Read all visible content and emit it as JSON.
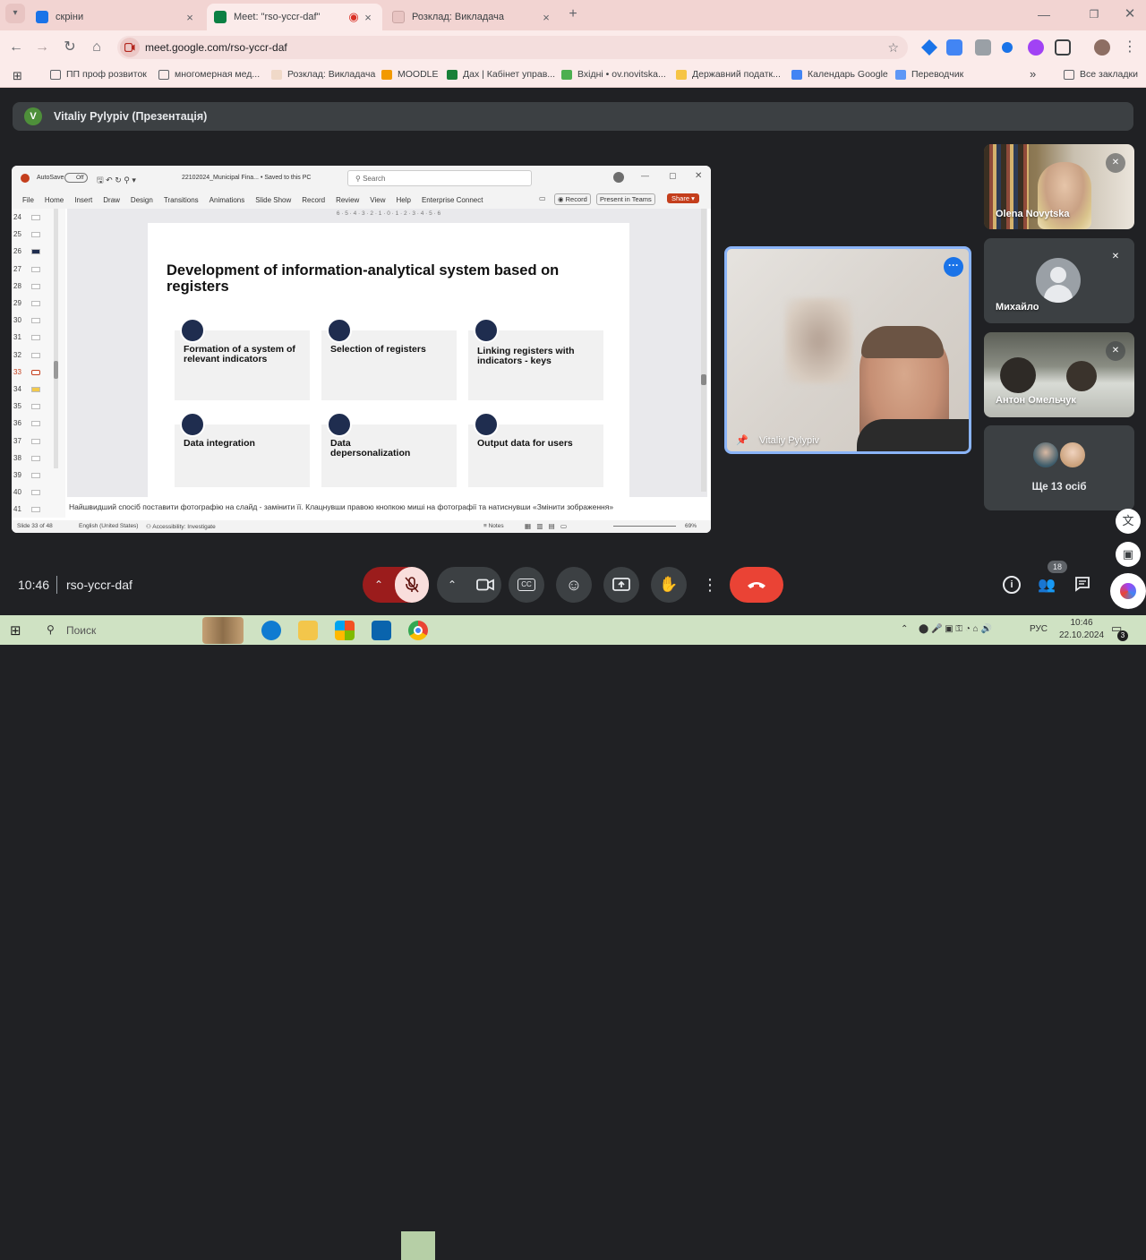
{
  "browser": {
    "tabs": [
      {
        "title": "скріни",
        "color": "#1a73e8"
      },
      {
        "title": "Meet: \"rso-yccr-daf\"",
        "color": "#0b8043"
      },
      {
        "title": "Розклад: Викладача",
        "color": "#e8c4c2"
      }
    ],
    "new_tab": "+",
    "url": "meet.google.com/rso-yccr-daf",
    "bookmarks": [
      "ПП проф розвиток",
      "многомерная мед...",
      "Розклад: Викладача",
      "MOODLE",
      "Дах | Кабінет управ...",
      "Вхідні • ov.novitska...",
      "Державний податк...",
      "Календарь Google",
      "Переводчик",
      "Все закладки"
    ],
    "more": "»"
  },
  "meet": {
    "presenter_initial": "V",
    "presenter_label": "Vitaliy Pylypiv (Презентація)",
    "meeting_code": "rso-yccr-daf",
    "time": "10:46",
    "participants_count": "18",
    "participants": [
      {
        "name": "Olena Novytska"
      },
      {
        "name": "Михайло"
      },
      {
        "name": "Антон Омельчук"
      },
      {
        "name": "Ще 13 осіб"
      }
    ],
    "pinned_name": "Vitaliy Pylypiv",
    "accent": "#8ab4f8",
    "hangup_color": "#ea4335"
  },
  "powerpoint": {
    "autosave": "AutoSave",
    "autosave_state": "Off",
    "file_name": "22102024_Municipal Fina... • Saved to this PC",
    "search_placeholder": "Search",
    "menu": [
      "File",
      "Home",
      "Insert",
      "Draw",
      "Design",
      "Transitions",
      "Animations",
      "Slide Show",
      "Record",
      "Review",
      "View",
      "Help",
      "Enterprise Connect"
    ],
    "record": "Record",
    "present_teams": "Present in Teams",
    "share": "Share",
    "slide_numbers": [
      "24",
      "25",
      "26",
      "27",
      "28",
      "29",
      "30",
      "31",
      "32",
      "33",
      "34",
      "35",
      "36",
      "37",
      "38",
      "39",
      "40",
      "41"
    ],
    "ruler_top": "6 · 5 · 4 · 3 · 2 · 1 · 0 · 1 · 2 · 3 · 4 · 5 · 6",
    "slide_title": "Development of information-analytical system based on registers",
    "cards": [
      "Formation of a system of relevant indicators",
      "Selection of registers",
      "Linking registers with indicators - keys",
      "Data integration",
      "Data depersonalization",
      "Output data for users"
    ],
    "notes": "Найшвидший спосіб поставити фотографію на слайд - замінити її. Клацнувши правою кнопкою миші на фотографії та натиснувши «Змінити зображення»",
    "status_slide": "Slide 33 of 48",
    "status_lang": "English (United States)",
    "status_access": "Accessibility: Investigate",
    "status_notes": "Notes",
    "status_zoom": "69%"
  },
  "taskbar": {
    "search_placeholder": "Поиск",
    "lang": "РУС",
    "clock_time": "10:46",
    "clock_date": "22.10.2024",
    "notif": "3"
  }
}
